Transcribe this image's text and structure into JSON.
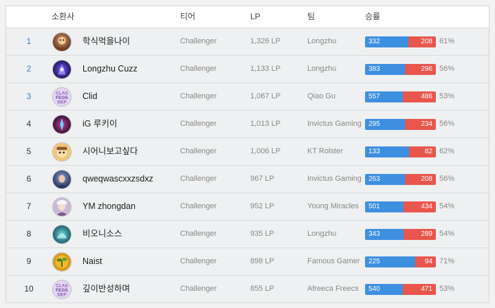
{
  "header": {
    "summoner": "소환사",
    "tier": "티어",
    "lp": "LP",
    "team": "팀",
    "winrate": "승률"
  },
  "colors": {
    "win_bar": "#3d8fe0",
    "loss_bar": "#e8564c",
    "top_rank": "#3c7fc9",
    "row_bg": "#eef0f1"
  },
  "rows": [
    {
      "rank": "1",
      "avatar_icon": "champion-avatar-icon",
      "name": "학식먹을나이",
      "tier": "Challenger",
      "lp": "1,326 LP",
      "team": "Longzhu",
      "wins": "332",
      "losses": "208",
      "win_fraction": 0.61,
      "pct": "61%"
    },
    {
      "rank": "2",
      "avatar_icon": "champion-avatar-icon",
      "name": "Longzhu Cuzz",
      "tier": "Challenger",
      "lp": "1,133 LP",
      "team": "Longzhu",
      "wins": "383",
      "losses": "296",
      "win_fraction": 0.56,
      "pct": "56%"
    },
    {
      "rank": "3",
      "avatar_icon": "clid-logo-avatar-icon",
      "name": "Clid",
      "tier": "Challenger",
      "lp": "1,067 LP",
      "team": "Qiao Gu",
      "wins": "557",
      "losses": "486",
      "win_fraction": 0.53,
      "pct": "53%"
    },
    {
      "rank": "4",
      "avatar_icon": "champion-avatar-icon",
      "name": "iG 루키이",
      "tier": "Challenger",
      "lp": "1,013 LP",
      "team": "Invictus Gaming",
      "wins": "295",
      "losses": "234",
      "win_fraction": 0.56,
      "pct": "56%"
    },
    {
      "rank": "5",
      "avatar_icon": "champion-avatar-icon",
      "name": "시어니보고싶다",
      "tier": "Challenger",
      "lp": "1,006 LP",
      "team": "KT Rolster",
      "wins": "133",
      "losses": "82",
      "win_fraction": 0.62,
      "pct": "62%"
    },
    {
      "rank": "6",
      "avatar_icon": "champion-avatar-icon",
      "name": "qweqwascxxzsdxz",
      "tier": "Challenger",
      "lp": "967 LP",
      "team": "Invictus Gaming",
      "wins": "263",
      "losses": "208",
      "win_fraction": 0.56,
      "pct": "56%"
    },
    {
      "rank": "7",
      "avatar_icon": "champion-avatar-icon",
      "name": "YM zhongdan",
      "tier": "Challenger",
      "lp": "952 LP",
      "team": "Young Miracles",
      "wins": "501",
      "losses": "434",
      "win_fraction": 0.54,
      "pct": "54%"
    },
    {
      "rank": "8",
      "avatar_icon": "champion-avatar-icon",
      "name": "비오니소스",
      "tier": "Challenger",
      "lp": "935 LP",
      "team": "Longzhu",
      "wins": "343",
      "losses": "289",
      "win_fraction": 0.54,
      "pct": "54%"
    },
    {
      "rank": "9",
      "avatar_icon": "sprout-avatar-icon",
      "name": "Naist",
      "tier": "Challenger",
      "lp": "898 LP",
      "team": "Famous Gamer",
      "wins": "225",
      "losses": "94",
      "win_fraction": 0.71,
      "pct": "71%"
    },
    {
      "rank": "10",
      "avatar_icon": "clid-logo-avatar-icon",
      "name": "깊이반성하며",
      "tier": "Challenger",
      "lp": "855 LP",
      "team": "Afreeca Freecs",
      "wins": "540",
      "losses": "471",
      "win_fraction": 0.53,
      "pct": "53%"
    }
  ]
}
